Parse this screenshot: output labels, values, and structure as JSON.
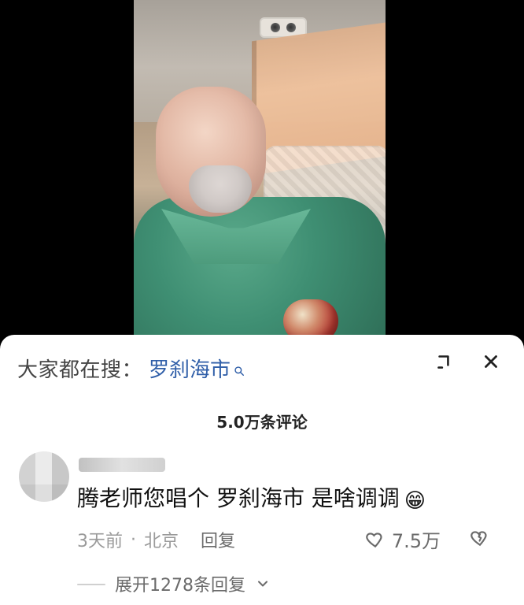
{
  "search_banner": {
    "prefix": "大家都在搜：",
    "term": "罗刹海市"
  },
  "top_actions": {
    "icons": {
      "collapse": "collapse-icon",
      "close": "close-icon"
    }
  },
  "comments_header": {
    "count_label": "5.0万条评论"
  },
  "comment": {
    "text": "腾老师您唱个  罗刹海市  是啥调调",
    "emoji": "😁",
    "time": "3天前",
    "separator": "·",
    "location": "北京",
    "reply_label": "回复",
    "likes": "7.5万",
    "expand_label": "展开1278条回复"
  },
  "colors": {
    "accent_link": "#2f5ea8",
    "text_primary": "#111111",
    "text_secondary": "#9a9a9a",
    "panel_bg": "#ffffff",
    "video_bg": "#000000"
  }
}
